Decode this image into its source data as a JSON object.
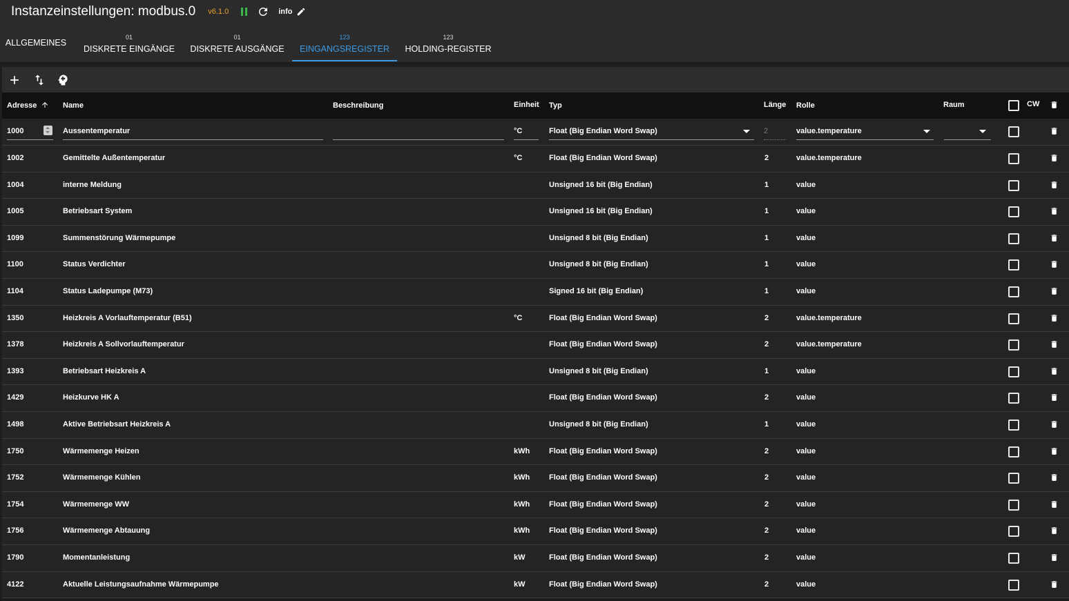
{
  "header": {
    "title": "Instanzeinstellungen: modbus.0",
    "version": "v6.1.0",
    "info_label": "info"
  },
  "tabs": [
    {
      "count": "",
      "label": "ALLGEMEINES"
    },
    {
      "count": "01",
      "label": "DISKRETE EINGÄNGE"
    },
    {
      "count": "01",
      "label": "DISKRETE AUSGÄNGE"
    },
    {
      "count": "123",
      "label": "EINGANGSREGISTER"
    },
    {
      "count": "123",
      "label": "HOLDING-REGISTER"
    }
  ],
  "active_tab": "EINGANGSREGISTER",
  "accent_color": "#3b9be6",
  "table": {
    "columns": {
      "address": "Adresse",
      "name": "Name",
      "description": "Beschreibung",
      "unit": "Einheit",
      "type": "Typ",
      "length": "Länge",
      "role": "Rolle",
      "room": "Raum",
      "cw": "CW"
    },
    "sort_column": "Adresse",
    "edit_row": {
      "address": "1000",
      "name": "Aussentemperatur",
      "description": "",
      "unit": "°C",
      "type": "Float (Big Endian Word Swap)",
      "length": "2",
      "role": "value.temperature",
      "room": ""
    },
    "rows": [
      {
        "address": "1002",
        "name": "Gemittelte Außentemperatur",
        "unit": "°C",
        "type": "Float (Big Endian Word Swap)",
        "length": "2",
        "role": "value.temperature"
      },
      {
        "address": "1004",
        "name": "interne Meldung",
        "unit": "",
        "type": "Unsigned 16 bit (Big Endian)",
        "length": "1",
        "role": "value"
      },
      {
        "address": "1005",
        "name": "Betriebsart System",
        "unit": "",
        "type": "Unsigned 16 bit (Big Endian)",
        "length": "1",
        "role": "value"
      },
      {
        "address": "1099",
        "name": "Summenstörung Wärmepumpe",
        "unit": "",
        "type": "Unsigned 8 bit (Big Endian)",
        "length": "1",
        "role": "value"
      },
      {
        "address": "1100",
        "name": "Status Verdichter",
        "unit": "",
        "type": "Unsigned 8 bit (Big Endian)",
        "length": "1",
        "role": "value"
      },
      {
        "address": "1104",
        "name": "Status Ladepumpe (M73)",
        "unit": "",
        "type": "Signed 16 bit (Big Endian)",
        "length": "1",
        "role": "value"
      },
      {
        "address": "1350",
        "name": "Heizkreis A Vorlauftemperatur (B51)",
        "unit": "°C",
        "type": "Float (Big Endian Word Swap)",
        "length": "2",
        "role": "value.temperature"
      },
      {
        "address": "1378",
        "name": "Heizkreis A Sollvorlauftemperatur",
        "unit": "",
        "type": "Float (Big Endian Word Swap)",
        "length": "2",
        "role": "value.temperature"
      },
      {
        "address": "1393",
        "name": "Betriebsart Heizkreis A",
        "unit": "",
        "type": "Unsigned 8 bit (Big Endian)",
        "length": "1",
        "role": "value"
      },
      {
        "address": "1429",
        "name": "Heizkurve HK A",
        "unit": "",
        "type": "Float (Big Endian Word Swap)",
        "length": "2",
        "role": "value"
      },
      {
        "address": "1498",
        "name": "Aktive Betriebsart Heizkreis A",
        "unit": "",
        "type": "Unsigned 8 bit (Big Endian)",
        "length": "1",
        "role": "value"
      },
      {
        "address": "1750",
        "name": "Wärmemenge Heizen",
        "unit": "kWh",
        "type": "Float (Big Endian Word Swap)",
        "length": "2",
        "role": "value"
      },
      {
        "address": "1752",
        "name": "Wärmemenge Kühlen",
        "unit": "kWh",
        "type": "Float (Big Endian Word Swap)",
        "length": "2",
        "role": "value"
      },
      {
        "address": "1754",
        "name": "Wärmemenge WW",
        "unit": "kWh",
        "type": "Float (Big Endian Word Swap)",
        "length": "2",
        "role": "value"
      },
      {
        "address": "1756",
        "name": "Wärmemenge Abtauung",
        "unit": "kWh",
        "type": "Float (Big Endian Word Swap)",
        "length": "2",
        "role": "value"
      },
      {
        "address": "1790",
        "name": "Momentanleistung",
        "unit": "kW",
        "type": "Float (Big Endian Word Swap)",
        "length": "2",
        "role": "value"
      },
      {
        "address": "4122",
        "name": "Aktuelle Leistungsaufnahme Wärmepumpe",
        "unit": "kW",
        "type": "Float (Big Endian Word Swap)",
        "length": "2",
        "role": "value"
      }
    ]
  }
}
